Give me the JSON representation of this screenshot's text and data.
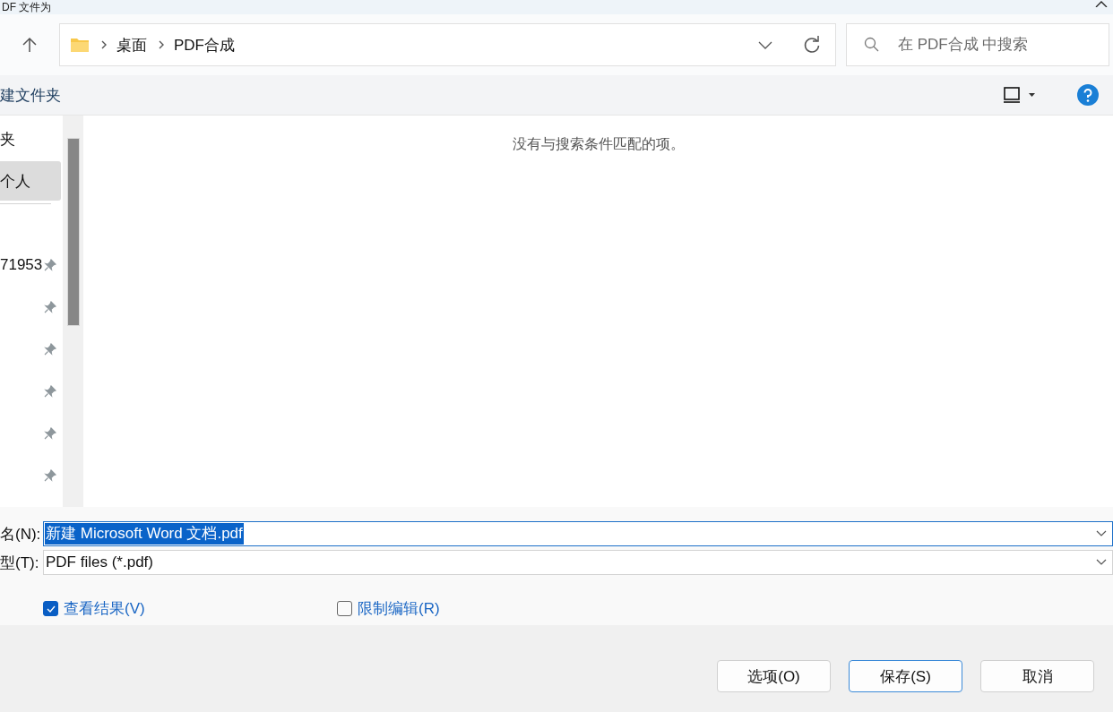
{
  "window": {
    "title": "DF 文件为"
  },
  "nav": {
    "breadcrumb": [
      "桌面",
      "PDF合成"
    ],
    "search": {
      "placeholder": "在 PDF合成 中搜索"
    }
  },
  "toolbar": {
    "new_folder": "建文件夹"
  },
  "sidebar": {
    "items": [
      {
        "label": "夹",
        "selected": false,
        "pinned": false
      },
      {
        "label": "个人",
        "selected": true,
        "pinned": false
      },
      {
        "kind": "divider"
      },
      {
        "label": "71953",
        "selected": false,
        "pinned": true
      },
      {
        "selected": false,
        "pinned": true
      },
      {
        "selected": false,
        "pinned": true
      },
      {
        "selected": false,
        "pinned": true
      },
      {
        "selected": false,
        "pinned": true
      },
      {
        "selected": false,
        "pinned": true
      }
    ]
  },
  "content": {
    "empty_message": "没有与搜索条件匹配的项。"
  },
  "form": {
    "filename": {
      "label": "名(N):",
      "value": "新建 Microsoft Word 文档.pdf"
    },
    "filetype": {
      "label": "型(T):",
      "value": "PDF files (*.pdf)"
    },
    "options": [
      {
        "label": "查看结果(V)",
        "checked": true
      },
      {
        "label": "限制编辑(R)",
        "checked": false
      }
    ]
  },
  "buttons": [
    {
      "label": "选项(O)",
      "default": false
    },
    {
      "label": "保存(S)",
      "default": true
    },
    {
      "label": "取消",
      "default": false
    }
  ]
}
